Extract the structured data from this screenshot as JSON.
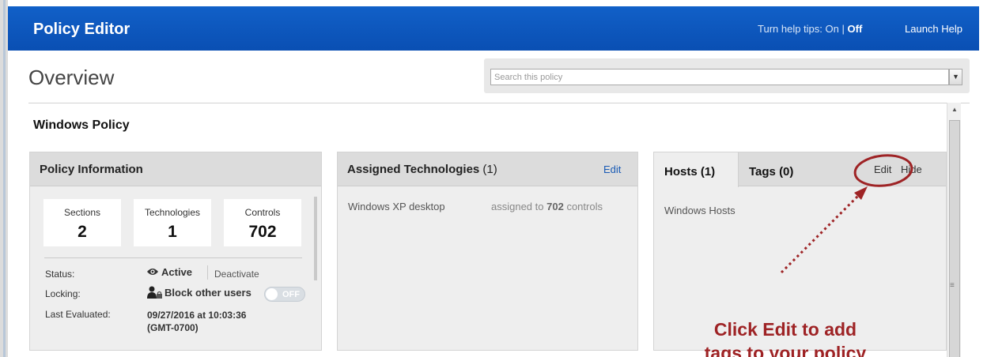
{
  "header": {
    "title": "Policy Editor",
    "help_tips_prefix": "Turn help tips:",
    "help_tips_on": "On",
    "help_tips_sep": "|",
    "help_tips_off": "Off",
    "launch_help": "Launch Help"
  },
  "page": {
    "heading": "Overview",
    "search_placeholder": "Search this policy",
    "policy_name": "Windows Policy"
  },
  "policy_info": {
    "title": "Policy Information",
    "stats": [
      {
        "label": "Sections",
        "value": "2"
      },
      {
        "label": "Technologies",
        "value": "1"
      },
      {
        "label": "Controls",
        "value": "702"
      }
    ],
    "status_label": "Status:",
    "status_value": "Active",
    "deactivate": "Deactivate",
    "locking_label": "Locking:",
    "locking_value": "Block other users",
    "toggle_text": "OFF",
    "last_evaluated_label": "Last Evaluated:",
    "last_evaluated_value": "09/27/2016 at 10:03:36\n(GMT-0700)"
  },
  "assigned_tech": {
    "title": "Assigned Technologies",
    "count": "(1)",
    "edit": "Edit",
    "item_name": "Windows XP desktop",
    "assigned_prefix": "assigned to",
    "assigned_count": "702",
    "assigned_suffix": "controls"
  },
  "hosts_panel": {
    "tab_hosts": "Hosts (1)",
    "tab_tags": "Tags (0)",
    "edit": "Edit",
    "hide": "Hide",
    "item": "Windows Hosts"
  },
  "annotation": {
    "text": "Click Edit to add\ntags to your policy",
    "color": "#9e2325"
  },
  "colors": {
    "header_blue": "#0a4fb3",
    "link_blue": "#1a5bb5",
    "panel_bg": "#eeeeee",
    "panel_head": "#dcdcdc"
  }
}
